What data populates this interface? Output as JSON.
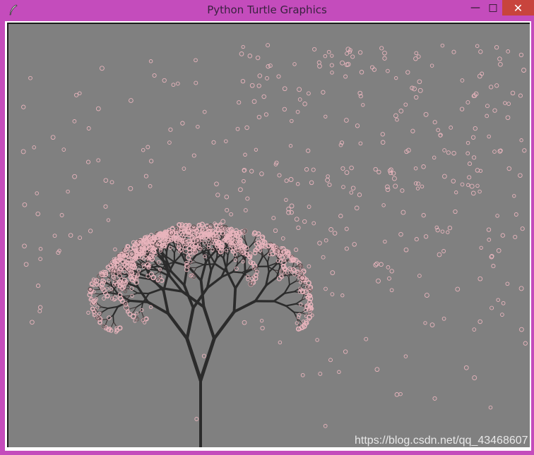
{
  "window": {
    "title": "Python Turtle Graphics",
    "minimize_glyph": "—",
    "maximize_glyph": "□",
    "close_glyph": "✕",
    "frame_color": "#c44cbc",
    "close_color": "#c8443d"
  },
  "canvas": {
    "background_color": "#808080",
    "branch_color": "#2b2b2b",
    "blossom_color": "#e8b4bc"
  },
  "watermark": "https://blog.csdn.net/qq_43468607"
}
